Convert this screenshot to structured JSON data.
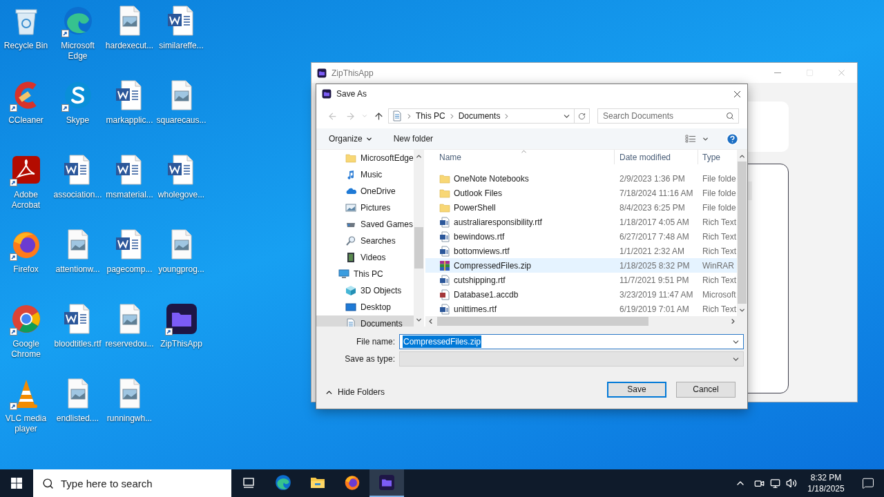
{
  "desktop_icons": [
    {
      "label": "Recycle Bin",
      "kind": "recycle",
      "shortcut": false
    },
    {
      "label": "CCleaner",
      "kind": "ccleaner",
      "shortcut": true
    },
    {
      "label": "Adobe Acrobat",
      "kind": "acrobat",
      "shortcut": true
    },
    {
      "label": "Firefox",
      "kind": "firefox",
      "shortcut": true
    },
    {
      "label": "Google Chrome",
      "kind": "chrome",
      "shortcut": true
    },
    {
      "label": "VLC media player",
      "kind": "vlc",
      "shortcut": true
    },
    {
      "label": "Microsoft Edge",
      "kind": "edge",
      "shortcut": true
    },
    {
      "label": "Skype",
      "kind": "skype",
      "shortcut": true
    },
    {
      "label": "association...",
      "kind": "word",
      "shortcut": false
    },
    {
      "label": "attentionw...",
      "kind": "image",
      "shortcut": false
    },
    {
      "label": "bloodtitles.rtf",
      "kind": "word",
      "shortcut": false
    },
    {
      "label": "endlisted....",
      "kind": "image",
      "shortcut": false
    },
    {
      "label": "hardexecut...",
      "kind": "image",
      "shortcut": false
    },
    {
      "label": "markapplic...",
      "kind": "word",
      "shortcut": false
    },
    {
      "label": "msmaterial...",
      "kind": "word",
      "shortcut": false
    },
    {
      "label": "pagecomp...",
      "kind": "word",
      "shortcut": false
    },
    {
      "label": "reservedou...",
      "kind": "image",
      "shortcut": false
    },
    {
      "label": "runningwh...",
      "kind": "image",
      "shortcut": false
    },
    {
      "label": "similareffe...",
      "kind": "word",
      "shortcut": false
    },
    {
      "label": "squarecaus...",
      "kind": "image",
      "shortcut": false
    },
    {
      "label": "wholegove...",
      "kind": "word",
      "shortcut": false
    },
    {
      "label": "youngprog...",
      "kind": "image",
      "shortcut": false
    },
    {
      "label": "ZipThisApp",
      "kind": "zipapp",
      "shortcut": true
    }
  ],
  "app_window": {
    "title": "ZipThisApp"
  },
  "dialog": {
    "title": "Save As",
    "address": [
      "This PC",
      "Documents"
    ],
    "search": {
      "placeholder": "Search Documents"
    },
    "toolbar": {
      "organize": "Organize",
      "new_folder": "New folder"
    },
    "nav_partial_group": [
      {
        "label": "MicrosoftEdge",
        "kind": "folder",
        "selected": false
      },
      {
        "label": "Music",
        "kind": "music",
        "selected": false
      },
      {
        "label": "OneDrive",
        "kind": "onedrive",
        "selected": false
      },
      {
        "label": "Pictures",
        "kind": "pictures",
        "selected": false
      },
      {
        "label": "Saved Games",
        "kind": "games",
        "selected": false
      },
      {
        "label": "Searches",
        "kind": "searches",
        "selected": false
      },
      {
        "label": "Videos",
        "kind": "videos",
        "selected": false
      }
    ],
    "nav_tree": [
      {
        "label": "This PC",
        "kind": "pc",
        "selected": false,
        "children": [
          {
            "label": "3D Objects",
            "kind": "objects",
            "selected": false
          },
          {
            "label": "Desktop",
            "kind": "desktop",
            "selected": false
          },
          {
            "label": "Documents",
            "kind": "documents",
            "selected": true
          }
        ]
      }
    ],
    "columns": [
      "Name",
      "Date modified",
      "Type"
    ],
    "files": [
      {
        "name": "OneNote Notebooks",
        "kind": "folder",
        "date": "2/9/2023 1:36 PM",
        "type": "File folde",
        "selected": false
      },
      {
        "name": "Outlook Files",
        "kind": "folder",
        "date": "7/18/2024 11:16 AM",
        "type": "File folde",
        "selected": false
      },
      {
        "name": "PowerShell",
        "kind": "folder",
        "date": "8/4/2023 6:25 PM",
        "type": "File folde",
        "selected": false
      },
      {
        "name": "australiaresponsibility.rtf",
        "kind": "word",
        "date": "1/18/2017 4:05 AM",
        "type": "Rich Text",
        "selected": false
      },
      {
        "name": "bewindows.rtf",
        "kind": "word",
        "date": "6/27/2017 7:48 AM",
        "type": "Rich Text",
        "selected": false
      },
      {
        "name": "bottomviews.rtf",
        "kind": "word",
        "date": "1/1/2021 2:32 AM",
        "type": "Rich Text",
        "selected": false
      },
      {
        "name": "CompressedFiles.zip",
        "kind": "zip",
        "date": "1/18/2025 8:32 PM",
        "type": "WinRAR",
        "selected": true
      },
      {
        "name": "cutshipping.rtf",
        "kind": "word",
        "date": "11/7/2021 9:51 PM",
        "type": "Rich Text",
        "selected": false
      },
      {
        "name": "Database1.accdb",
        "kind": "access",
        "date": "3/23/2019 11:47 AM",
        "type": "Microsoft",
        "selected": false
      },
      {
        "name": "unittimes.rtf",
        "kind": "word",
        "date": "6/19/2019 7:01 AM",
        "type": "Rich Text",
        "selected": false
      }
    ],
    "file_name_label": "File name:",
    "file_name": "CompressedFiles.zip",
    "save_type_label": "Save as type:",
    "hide_folders": "Hide Folders",
    "buttons": [
      {
        "label": "Save",
        "default": true
      },
      {
        "label": "Cancel",
        "default": false
      }
    ]
  },
  "taskbar": {
    "search_placeholder": "Type here to search",
    "apps": [
      {
        "kind": "taskview",
        "selected": false
      },
      {
        "kind": "edge",
        "selected": false
      },
      {
        "kind": "explorer",
        "selected": false
      },
      {
        "kind": "firefox",
        "selected": false
      },
      {
        "kind": "zipapp",
        "selected": true
      }
    ],
    "time": "8:32 PM",
    "date": "1/18/2025"
  }
}
